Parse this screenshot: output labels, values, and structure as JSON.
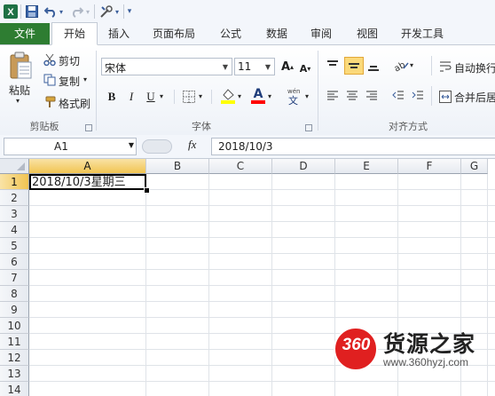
{
  "quick_access": {
    "icons": [
      "excel-logo-icon",
      "save-icon",
      "undo-icon",
      "redo-icon",
      "tools-icon",
      "customize-icon"
    ]
  },
  "tabs": [
    {
      "label": "文件"
    },
    {
      "label": "开始"
    },
    {
      "label": "插入"
    },
    {
      "label": "页面布局"
    },
    {
      "label": "公式"
    },
    {
      "label": "数据"
    },
    {
      "label": "审阅"
    },
    {
      "label": "视图"
    },
    {
      "label": "开发工具"
    }
  ],
  "ribbon": {
    "clipboard": {
      "paste_label": "粘贴",
      "cut_label": "剪切",
      "copy_label": "复制",
      "format_painter_label": "格式刷",
      "group_label": "剪贴板"
    },
    "font": {
      "font_name": "宋体",
      "font_size": "11",
      "bold": "B",
      "italic": "I",
      "underline": "U",
      "grow_font": "A",
      "shrink_font": "A",
      "font_color_letter": "A",
      "group_label": "字体",
      "fill_color": "#ffff00",
      "font_color": "#ff0000"
    },
    "alignment": {
      "wrap_text_label": "自动换行",
      "merge_center_label": "合并后居",
      "group_label": "对齐方式"
    }
  },
  "formula_bar": {
    "name_box": "A1",
    "fx_label": "fx",
    "formula": "2018/10/3"
  },
  "grid": {
    "columns": [
      "A",
      "B",
      "C",
      "D",
      "E",
      "F",
      "G"
    ],
    "rows": [
      "1",
      "2",
      "3",
      "4",
      "5",
      "6",
      "7",
      "8",
      "9",
      "10",
      "11",
      "12",
      "13",
      "14"
    ],
    "selected_cell": "A1",
    "cell_A1": "2018/10/3星期三"
  },
  "watermark": {
    "logo_number": "360",
    "brand": "货源之家",
    "url": "www.360hyzj.com"
  },
  "colors": {
    "file_tab": "#2e7d32",
    "selection_header": "#f1c451",
    "watermark_red": "#e02020"
  }
}
